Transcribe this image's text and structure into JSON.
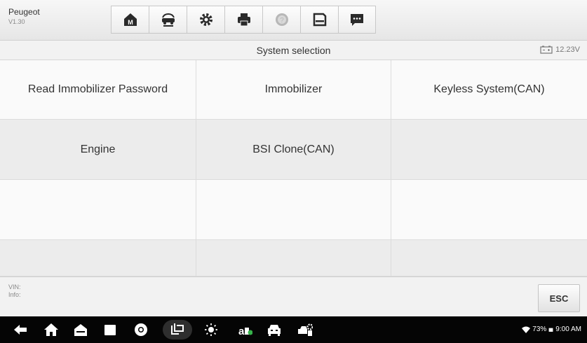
{
  "header": {
    "make": "Peugeot",
    "version": "V1.30",
    "toolbar_icons": [
      "home-icon",
      "vehicle-swap-icon",
      "settings-icon",
      "print-icon",
      "help-icon",
      "save-icon",
      "message-icon"
    ]
  },
  "titlebar": {
    "title": "System selection",
    "battery_voltage": "12.23V"
  },
  "systems": {
    "row1": [
      "Read Immobilizer Password",
      "Immobilizer",
      "Keyless System(CAN)"
    ],
    "row2": [
      "Engine",
      "BSI Clone(CAN)",
      ""
    ]
  },
  "footer": {
    "vin_label": "VIN:",
    "info_label": "Info:",
    "esc_label": "ESC"
  },
  "android_nav": {
    "icons": [
      "back-icon",
      "home-icon",
      "vci-home-icon",
      "recent-apps-icon",
      "chrome-icon",
      "screenshot-icon",
      "brightness-icon",
      "vci-status-icon",
      "car-icon",
      "car-settings-icon"
    ],
    "wifi_battery": "73%",
    "time": "9:00 AM"
  },
  "colors": {
    "accent": "#2a2a2a",
    "help_disabled": "#b7b7b7",
    "navbar": "#050505"
  }
}
